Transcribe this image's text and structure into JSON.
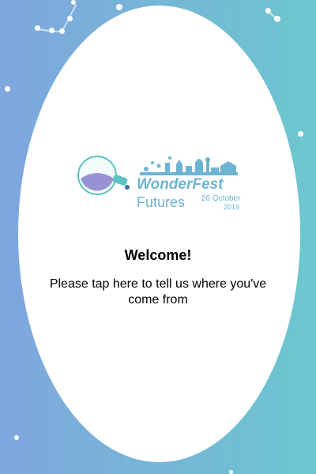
{
  "colors": {
    "bg_left": "#7fa6de",
    "bg_right": "#6cc7cf",
    "oval": "#ffffff",
    "logo_primary": "#6fb3d2",
    "logo_secondary": "#8c86cf",
    "logo_teal": "#5bc4c0"
  },
  "logo": {
    "title": "WonderFest",
    "subtitle": "Futures",
    "date_line1": "26 October",
    "date_line2": "2019"
  },
  "welcome": {
    "heading": "Welcome!",
    "message": "Please tap here to tell us where you've come from"
  }
}
